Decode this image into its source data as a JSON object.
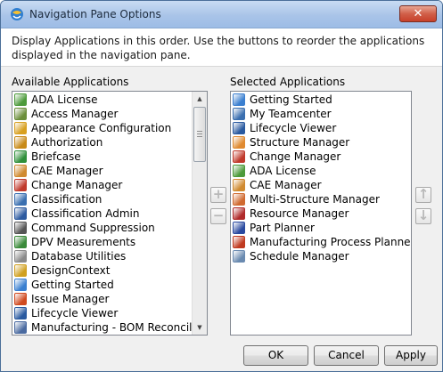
{
  "window": {
    "title": "Navigation Pane Options",
    "close_glyph": "✕"
  },
  "instructions": "Display Applications in this order. Use the buttons to reorder the applications displayed in the navigation pane.",
  "available": {
    "label": "Available Applications",
    "items": [
      {
        "label": "ADA License",
        "icon": "ada-license-icon",
        "color": "#4c9a3a"
      },
      {
        "label": "Access Manager",
        "icon": "access-manager-icon",
        "color": "#6b8e3a"
      },
      {
        "label": "Appearance Configuration",
        "icon": "appearance-config-icon",
        "color": "#d8a020"
      },
      {
        "label": "Authorization",
        "icon": "authorization-icon",
        "color": "#c88a18"
      },
      {
        "label": "Briefcase",
        "icon": "briefcase-icon",
        "color": "#2f8f3a"
      },
      {
        "label": "CAE Manager",
        "icon": "cae-manager-icon",
        "color": "#d08a30"
      },
      {
        "label": "Change Manager",
        "icon": "change-manager-icon",
        "color": "#c0392b"
      },
      {
        "label": "Classification",
        "icon": "classification-icon",
        "color": "#3a6fb0"
      },
      {
        "label": "Classification Admin",
        "icon": "classification-admin-icon",
        "color": "#2c5aa0"
      },
      {
        "label": "Command Suppression",
        "icon": "command-suppression-icon",
        "color": "#555555"
      },
      {
        "label": "DPV Measurements",
        "icon": "dpv-measurements-icon",
        "color": "#3a8a3a"
      },
      {
        "label": "Database Utilities",
        "icon": "database-utilities-icon",
        "color": "#8a8a8a"
      },
      {
        "label": "DesignContext",
        "icon": "designcontext-icon",
        "color": "#d0a020"
      },
      {
        "label": "Getting Started",
        "icon": "getting-started-icon",
        "color": "#3a7fd0"
      },
      {
        "label": "Issue Manager",
        "icon": "issue-manager-icon",
        "color": "#d04a20"
      },
      {
        "label": "Lifecycle Viewer",
        "icon": "lifecycle-viewer-icon",
        "color": "#2a5aa0"
      },
      {
        "label": "Manufacturing - BOM Reconcili...",
        "icon": "manufacturing-bom-icon",
        "color": "#4a6aa0"
      }
    ]
  },
  "selected": {
    "label": "Selected Applications",
    "items": [
      {
        "label": "Getting Started",
        "icon": "getting-started-icon",
        "color": "#3a7fd0"
      },
      {
        "label": "My Teamcenter",
        "icon": "my-teamcenter-icon",
        "color": "#3a6fb0"
      },
      {
        "label": "Lifecycle Viewer",
        "icon": "lifecycle-viewer-icon",
        "color": "#2a5aa0"
      },
      {
        "label": "Structure Manager",
        "icon": "structure-manager-icon",
        "color": "#e08a30"
      },
      {
        "label": "Change Manager",
        "icon": "change-manager-icon",
        "color": "#c0392b"
      },
      {
        "label": "ADA License",
        "icon": "ada-license-icon",
        "color": "#4c9a3a"
      },
      {
        "label": "CAE Manager",
        "icon": "cae-manager-icon",
        "color": "#d08a30"
      },
      {
        "label": "Multi-Structure Manager",
        "icon": "multi-structure-manager-icon",
        "color": "#d06a30"
      },
      {
        "label": "Resource Manager",
        "icon": "resource-manager-icon",
        "color": "#b02a2a"
      },
      {
        "label": "Part Planner",
        "icon": "part-planner-icon",
        "color": "#2a4aa0"
      },
      {
        "label": "Manufacturing Process Planner",
        "icon": "manufacturing-process-planner-icon",
        "color": "#c03a20"
      },
      {
        "label": "Schedule Manager",
        "icon": "schedule-manager-icon",
        "color": "#6a8ab0"
      }
    ]
  },
  "controls": {
    "add_glyph": "+",
    "remove_glyph": "−",
    "up_glyph": "↑",
    "down_glyph": "↓"
  },
  "footer": {
    "ok": "OK",
    "cancel": "Cancel",
    "apply": "Apply"
  }
}
